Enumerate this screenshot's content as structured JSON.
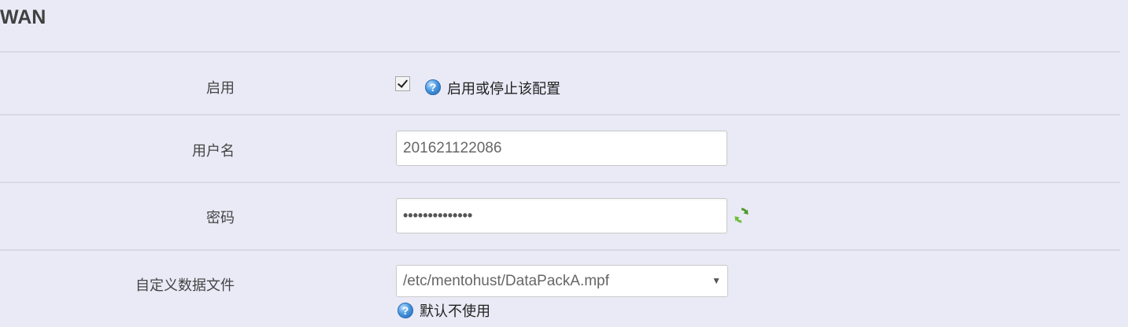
{
  "section": {
    "title": "WAN"
  },
  "fields": {
    "enable": {
      "label": "启用",
      "checked": true,
      "help_icon": "help-icon",
      "help_text": "启用或停止该配置"
    },
    "username": {
      "label": "用户名",
      "value": "201621122086"
    },
    "password": {
      "label": "密码",
      "value": "••••••••••••••",
      "reveal_icon": "refresh-icon"
    },
    "data_file": {
      "label": "自定义数据文件",
      "selected": "/etc/mentohust/DataPackA.mpf",
      "help_icon": "help-icon",
      "help_text": "默认不使用"
    }
  },
  "icons": {
    "dropdown": "▼",
    "help": "?"
  },
  "colors": {
    "background": "#e9eaf6",
    "divider": "#d8d9e4",
    "help_icon": "#4b9ae0",
    "refresh_icon": "#5aa832"
  }
}
